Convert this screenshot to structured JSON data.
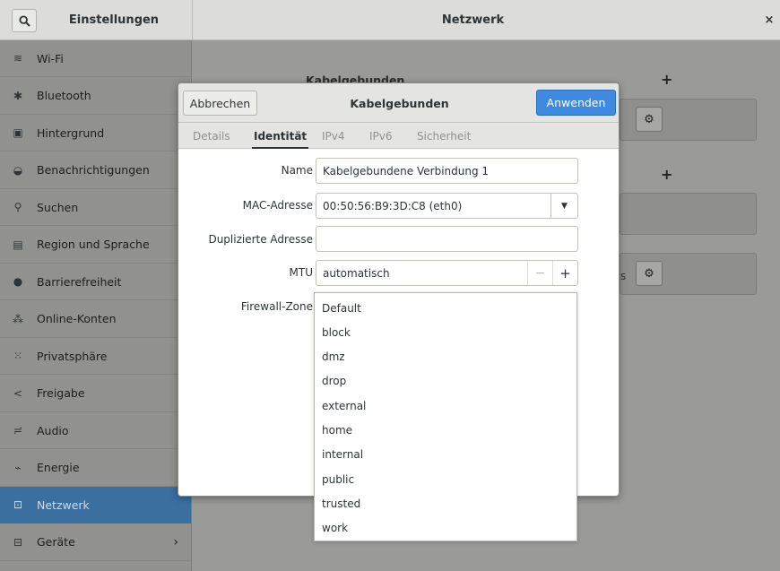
{
  "header": {
    "left_title": "Einstellungen",
    "title": "Netzwerk",
    "close_glyph": "×"
  },
  "sidebar": {
    "items": [
      {
        "label": "Wi-Fi",
        "icon": "wifi-icon",
        "glyph": "≋"
      },
      {
        "label": "Bluetooth",
        "icon": "bluetooth-icon",
        "glyph": "✱"
      },
      {
        "label": "Hintergrund",
        "icon": "background-icon",
        "glyph": "▣"
      },
      {
        "label": "Benachrichtigungen",
        "icon": "notifications-icon",
        "glyph": "◒"
      },
      {
        "label": "Suchen",
        "icon": "search-icon",
        "glyph": "⚲"
      },
      {
        "label": "Region und Sprache",
        "icon": "region-icon",
        "glyph": "▤"
      },
      {
        "label": "Barrierefreiheit",
        "icon": "accessibility-icon",
        "glyph": "●"
      },
      {
        "label": "Online-Konten",
        "icon": "online-accounts-icon",
        "glyph": "⁂"
      },
      {
        "label": "Privatsphäre",
        "icon": "privacy-icon",
        "glyph": "⁙"
      },
      {
        "label": "Freigabe",
        "icon": "share-icon",
        "glyph": "<"
      },
      {
        "label": "Audio",
        "icon": "audio-icon",
        "glyph": "≓"
      },
      {
        "label": "Energie",
        "icon": "power-icon",
        "glyph": "⌁"
      },
      {
        "label": "Netzwerk",
        "icon": "network-icon",
        "glyph": "⊡"
      },
      {
        "label": "Geräte",
        "icon": "devices-icon",
        "glyph": "⊟"
      }
    ],
    "active_index": 12,
    "more_arrow": "›"
  },
  "background": {
    "section_title": "Kabelgebunden",
    "plus1": "+",
    "plus2": "+",
    "partial_text": "s"
  },
  "dialog": {
    "cancel_label": "Abbrechen",
    "title": "Kabelgebunden",
    "apply_label": "Anwenden",
    "tabs": [
      "Details",
      "Identität",
      "IPv4",
      "IPv6",
      "Sicherheit"
    ],
    "active_tab": "Identität",
    "fields": {
      "name_label": "Name",
      "name_value": "Kabelgebundene Verbindung 1",
      "mac_label": "MAC-Adresse",
      "mac_value": "00:50:56:B9:3D:C8 (eth0)",
      "clone_label": "Duplizierte Adresse",
      "clone_value": "",
      "mtu_label": "MTU",
      "mtu_value": "automatisch",
      "mtu_minus": "−",
      "mtu_plus": "+",
      "firewall_label": "Firewall-Zone"
    }
  },
  "firewall_zones": [
    "Default",
    "block",
    "dmz",
    "drop",
    "external",
    "home",
    "internal",
    "public",
    "trusted",
    "work"
  ],
  "colors": {
    "accent": "#3d8ae0",
    "sidebar_active": "#3a6fa0"
  }
}
